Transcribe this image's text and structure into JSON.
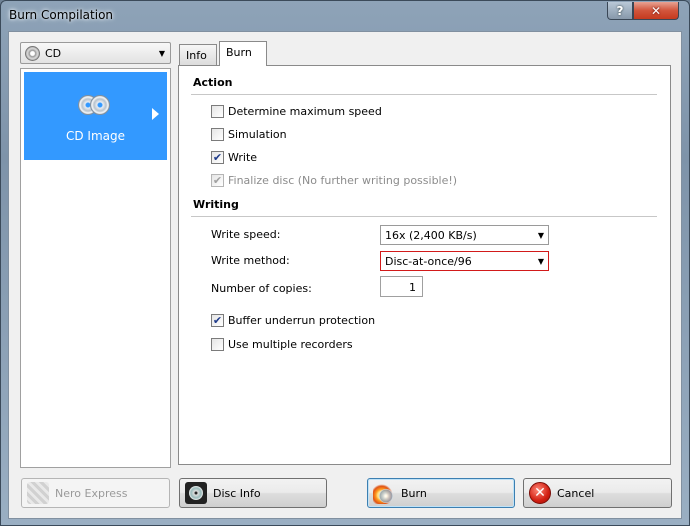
{
  "window": {
    "title": "Burn Compilation",
    "help": "?",
    "close": "✕"
  },
  "left": {
    "combo_value": "CD",
    "item_label": "CD Image"
  },
  "tabs": [
    {
      "label": "Info"
    },
    {
      "label": "Burn"
    }
  ],
  "action": {
    "heading": "Action",
    "options": [
      {
        "label": "Determine maximum speed",
        "checked": false,
        "enabled": true
      },
      {
        "label": "Simulation",
        "checked": false,
        "enabled": true
      },
      {
        "label": "Write",
        "checked": true,
        "enabled": true
      },
      {
        "label": "Finalize disc (No further writing possible!)",
        "checked": true,
        "enabled": false
      }
    ]
  },
  "writing": {
    "heading": "Writing",
    "speed_label": "Write speed:",
    "speed_value": "16x (2,400 KB/s)",
    "method_label": "Write method:",
    "method_value": "Disc-at-once/96",
    "copies_label": "Number of copies:",
    "copies_value": "1",
    "options": [
      {
        "label": "Buffer underrun protection",
        "checked": true
      },
      {
        "label": "Use multiple recorders",
        "checked": false
      }
    ]
  },
  "buttons": {
    "nero_express": "Nero Express",
    "disc_info": "Disc Info",
    "burn": "Burn",
    "cancel": "Cancel"
  },
  "colors": {
    "selection": "#3399ff",
    "alert_border": "#d21a1a"
  }
}
